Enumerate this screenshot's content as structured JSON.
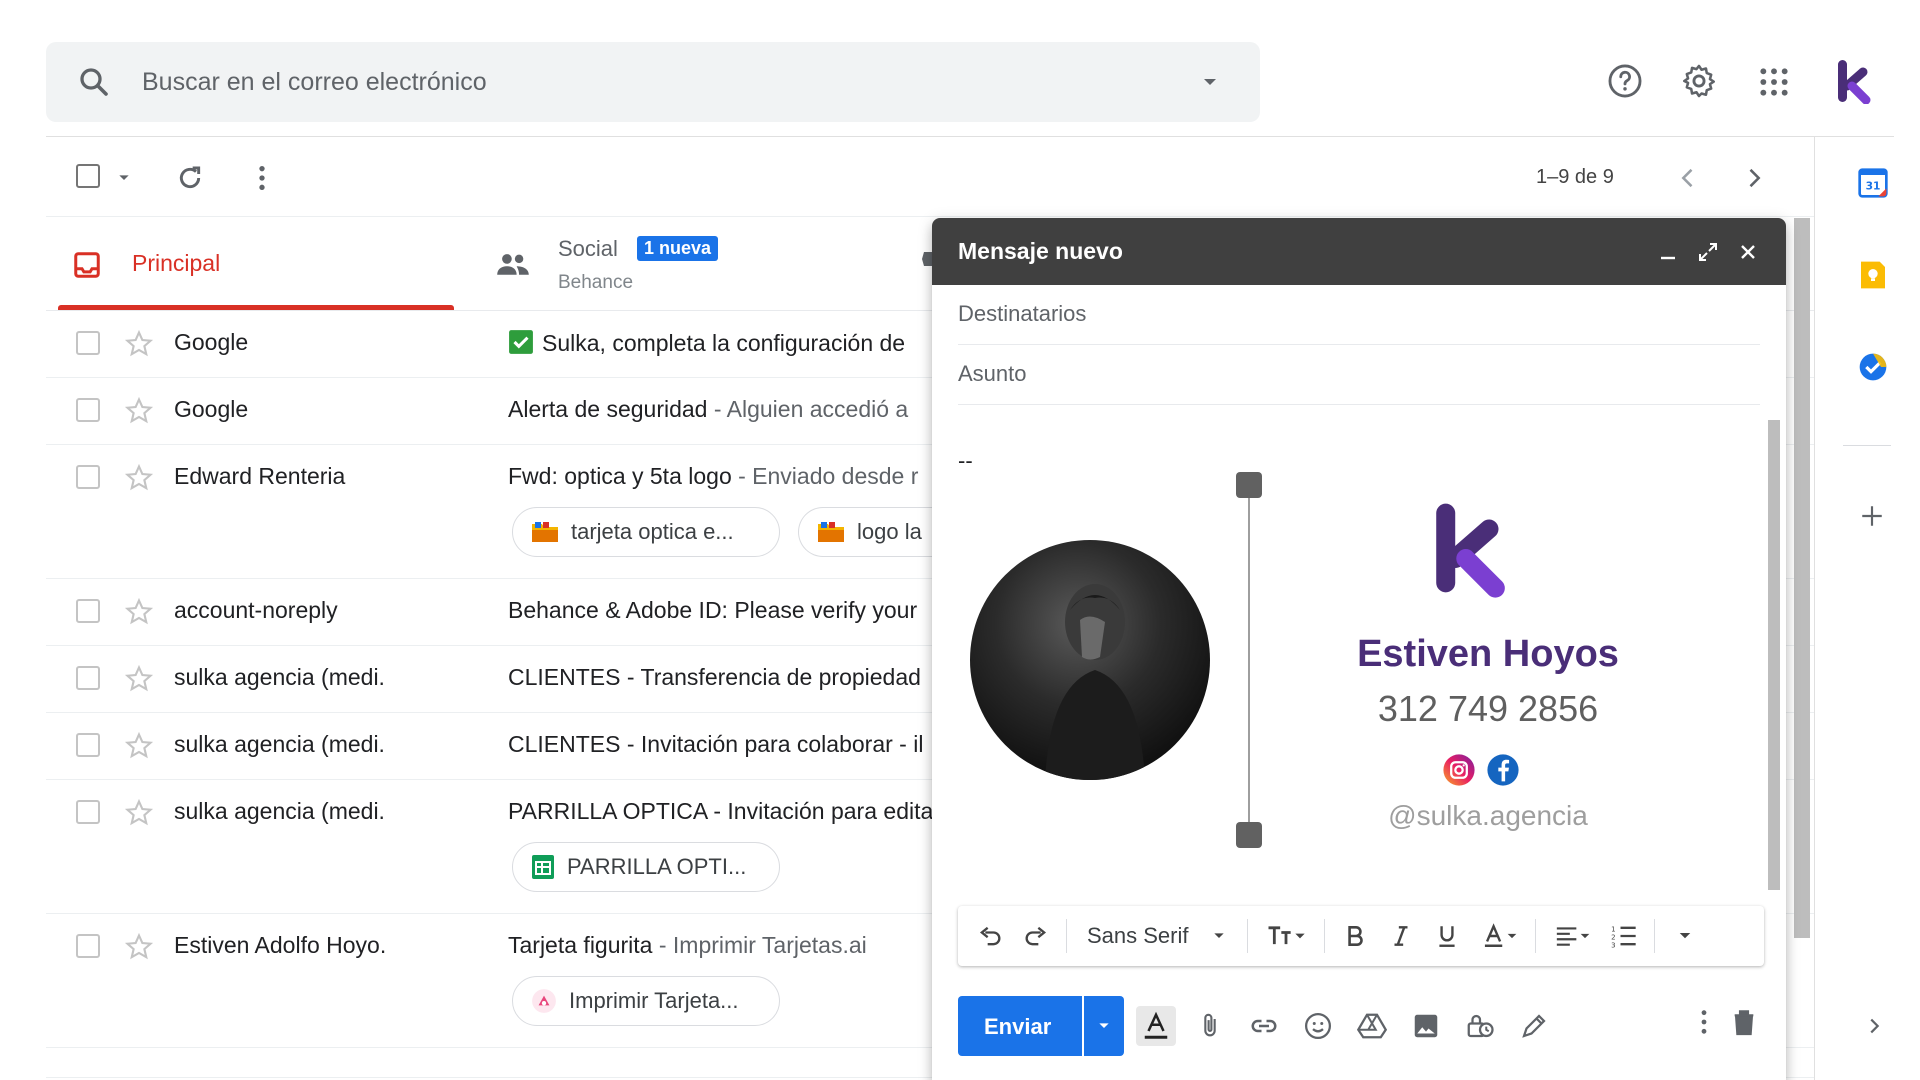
{
  "search": {
    "placeholder": "Buscar en el correo electrónico"
  },
  "toolbar": {
    "pagination": "1–9 de 9"
  },
  "tabs": {
    "primary": {
      "label": "Principal"
    },
    "social": {
      "label": "Social",
      "badge": "1 nueva",
      "sub": "Behance"
    }
  },
  "emails": [
    {
      "sender": "Google",
      "subject": "Sulka, completa la configuración de",
      "snippet": ""
    },
    {
      "sender": "Google",
      "subject": "Alerta de seguridad",
      "snippet": " - Alguien accedió a"
    },
    {
      "sender": "Edward Renteria",
      "subject": "Fwd: optica y 5ta logo",
      "snippet": " - Enviado desde r",
      "chips": [
        "tarjeta optica e...",
        "logo la"
      ]
    },
    {
      "sender": "account-noreply",
      "subject": "Behance & Adobe ID: Please verify your",
      "snippet": ""
    },
    {
      "sender": "sulka agencia (medi.",
      "subject": "CLIENTES - Transferencia de propiedad",
      "snippet": ""
    },
    {
      "sender": "sulka agencia (medi.",
      "subject": "CLIENTES - Invitación para colaborar - il",
      "snippet": ""
    },
    {
      "sender": "sulka agencia (medi.",
      "subject": "PARRILLA OPTICA - Invitación para edita",
      "snippet": "",
      "chips": [
        "PARRILLA OPTI..."
      ]
    },
    {
      "sender": "Estiven Adolfo Hoyo.",
      "subject": "Tarjeta figurita",
      "snippet": " - Imprimir Tarjetas.ai",
      "chips": [
        "Imprimir Tarjeta..."
      ]
    }
  ],
  "compose": {
    "title": "Mensaje nuevo",
    "to_placeholder": "Destinatarios",
    "subject_placeholder": "Asunto",
    "signature_dash": "--",
    "signature": {
      "name": "Estiven Hoyos",
      "phone": "312 749 2856",
      "handle": "@sulka.agencia"
    },
    "font": "Sans Serif",
    "send_label": "Enviar"
  },
  "colors": {
    "primary_red": "#d93025",
    "send_blue": "#1a73e8",
    "compose_header": "#404040",
    "brand_purple": "#4a2e78"
  }
}
